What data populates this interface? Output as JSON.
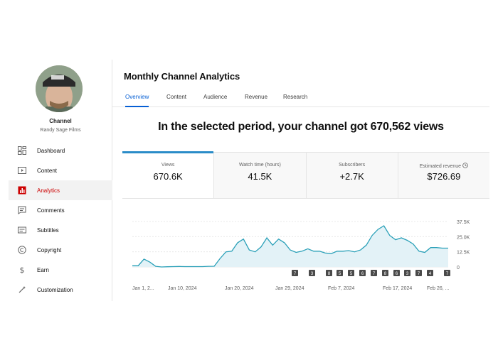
{
  "sidebar": {
    "channel_label": "Channel",
    "channel_name": "Randy Sage Films",
    "items": [
      {
        "label": "Dashboard",
        "icon": "dashboard-icon",
        "active": false
      },
      {
        "label": "Content",
        "icon": "content-icon",
        "active": false
      },
      {
        "label": "Analytics",
        "icon": "analytics-icon",
        "active": true
      },
      {
        "label": "Comments",
        "icon": "comments-icon",
        "active": false
      },
      {
        "label": "Subtitles",
        "icon": "subtitles-icon",
        "active": false
      },
      {
        "label": "Copyright",
        "icon": "copyright-icon",
        "active": false
      },
      {
        "label": "Earn",
        "icon": "earn-icon",
        "active": false
      },
      {
        "label": "Customization",
        "icon": "customization-icon",
        "active": false
      }
    ]
  },
  "main": {
    "title": "Monthly Channel Analytics",
    "tabs": [
      "Overview",
      "Content",
      "Audience",
      "Revenue",
      "Research"
    ],
    "active_tab": "Overview",
    "headline": "In the selected period, your channel got 670,562 views"
  },
  "metrics": [
    {
      "label": "Views",
      "value": "670.6K"
    },
    {
      "label": "Watch time (hours)",
      "value": "41.5K"
    },
    {
      "label": "Subscribers",
      "value": "+2.7K"
    },
    {
      "label": "Estimated revenue",
      "value": "$726.69"
    }
  ],
  "colors": {
    "accent": "#065fd4",
    "active_nav": "#cc0000",
    "line": "#2aa0b8",
    "area": "#e3f2f7"
  },
  "chart_data": {
    "type": "area",
    "series": [
      {
        "values": [
          1000,
          1000,
          6500,
          4000,
          500,
          0,
          200,
          300,
          400,
          300,
          300,
          300,
          300,
          500,
          600,
          7000,
          12500,
          13000,
          20000,
          23000,
          14000,
          12500,
          16500,
          24000,
          18000,
          23000,
          20000,
          14000,
          12000,
          13000,
          15000,
          13000,
          13000,
          11500,
          11000,
          13000,
          13000,
          13500,
          12500,
          14000,
          18000,
          26000,
          31000,
          34000,
          26000,
          22500,
          24000,
          22000,
          19000,
          13000,
          12000,
          16000,
          16000,
          15500,
          15500
        ]
      }
    ],
    "x_tick_labels": [
      "Jan 1, 2...",
      "Jan 10, 2024",
      "Jan 20, 2024",
      "Jan 29, 2024",
      "Feb 7, 2024",
      "Feb 17, 2024",
      "Feb 26, ..."
    ],
    "y_tick_labels": [
      "37.5K",
      "25.0K",
      "12.5K",
      "0"
    ],
    "ylim": [
      0,
      37500
    ],
    "markers": [
      "7",
      "3",
      "8",
      "5",
      "5",
      "6",
      "7",
      "8",
      "6",
      "3",
      "7",
      "4",
      "7"
    ],
    "grid": true,
    "legend": "none"
  }
}
